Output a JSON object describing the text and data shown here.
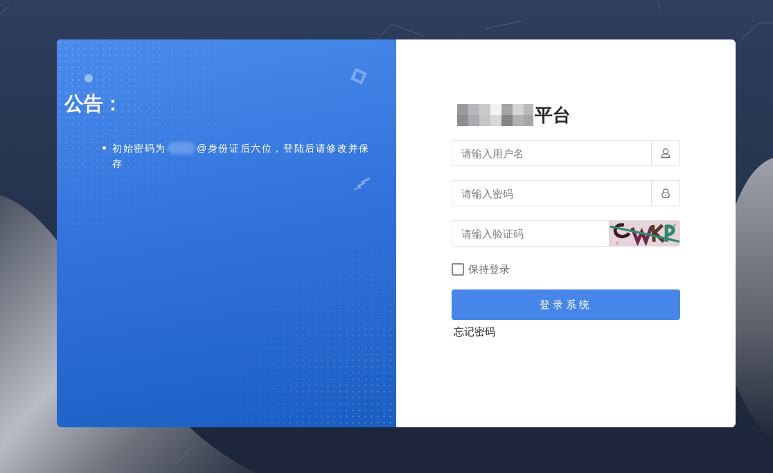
{
  "notice": {
    "title": "公告：",
    "items": [
      {
        "text_before": "初始密码为",
        "text_after": "@身份证后六位，登陆后请修改并保存"
      }
    ]
  },
  "login": {
    "title": "平台",
    "fields": [
      {
        "kind": "text",
        "placeholder": "请输入用户名"
      },
      {
        "kind": "password",
        "placeholder": "请输入密码"
      },
      {
        "kind": "captcha",
        "placeholder": "请输入验证码"
      }
    ],
    "remember": {
      "label": "保持登录",
      "checked": false
    },
    "submit": "登录系统",
    "forgot": "忘记密码"
  }
}
